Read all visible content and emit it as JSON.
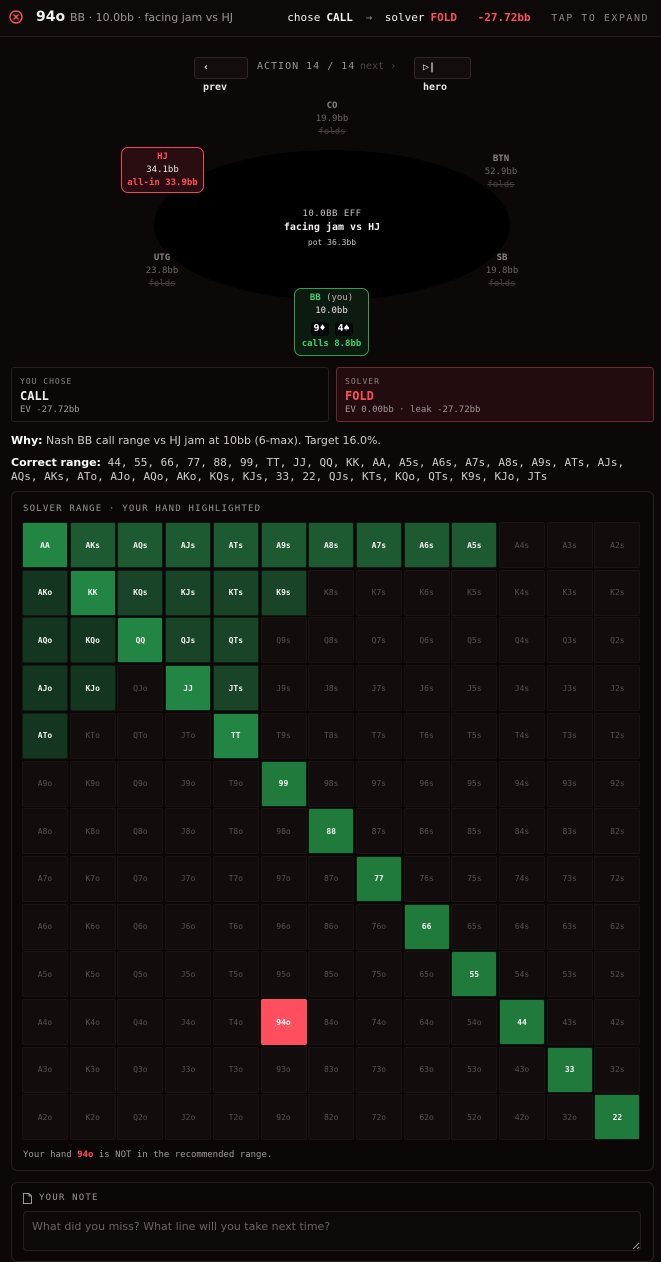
{
  "header": {
    "hand": "94o",
    "context": "BB · 10.0bb · facing jam vs HJ",
    "chose_label": "chose",
    "chose_action": "CALL",
    "arrow": "→",
    "solver_label": "solver",
    "solver_action": "FOLD",
    "ev_diff": "-27.72bb",
    "expand": "TAP TO EXPAND"
  },
  "nav": {
    "prev": "prev",
    "action": "ACTION 14 / 14",
    "next": "next",
    "hero": "hero"
  },
  "table": {
    "eff": "10.0BB EFF",
    "situation": "facing jam vs HJ",
    "pot": "pot 36.3bb",
    "seats": {
      "co": {
        "pos": "CO",
        "stack": "19.9bb",
        "status": "folds"
      },
      "hj": {
        "pos": "HJ",
        "stack": "34.1bb",
        "status": "all-in 33.9bb"
      },
      "btn": {
        "pos": "BTN",
        "stack": "52.9bb",
        "status": "folds"
      },
      "utg": {
        "pos": "UTG",
        "stack": "23.8bb",
        "status": "folds"
      },
      "sb": {
        "pos": "SB",
        "stack": "19.8bb",
        "status": "folds"
      },
      "bb": {
        "pos": "BB",
        "you": "(you)",
        "stack": "10.0bb",
        "card1": "9♦",
        "card2": "4♠",
        "status": "calls 8.8bb"
      }
    }
  },
  "you_chose": {
    "label": "YOU CHOSE",
    "action": "CALL",
    "ev": "EV -27.72bb"
  },
  "solver": {
    "label": "SOLVER",
    "action": "FOLD",
    "ev": "EV 0.00bb · leak -27.72bb"
  },
  "why": {
    "label": "Why:",
    "text": "Nash BB call range vs HJ jam at 10bb (6-max). Target 16.0%."
  },
  "correct_range": {
    "label": "Correct range:",
    "text": "44, 55, 66, 77, 88, 99, TT, JJ, QQ, KK, AA, A5s, A6s, A7s, A8s, A9s, ATs, AJs, AQs, AKs, ATo, AJo, AQo, AKo, KQs, KJs, 33, 22, QJs, KTs, KQo, QTs, K9s, KJo, JTs"
  },
  "grid": {
    "title": "SOLVER RANGE · YOUR HAND HIGHLIGHTED",
    "ranks": [
      "A",
      "K",
      "Q",
      "J",
      "T",
      "9",
      "8",
      "7",
      "6",
      "5",
      "4",
      "3",
      "2"
    ],
    "in_range": [
      "AA",
      "AKs",
      "AQs",
      "AJs",
      "ATs",
      "A9s",
      "A8s",
      "A7s",
      "A6s",
      "A5s",
      "AKo",
      "KK",
      "KQs",
      "KJs",
      "KTs",
      "K9s",
      "AQo",
      "KQo",
      "QQ",
      "QJs",
      "QTs",
      "AJo",
      "KJo",
      "JJ",
      "JTs",
      "ATo",
      "TT",
      "99",
      "88",
      "77",
      "66",
      "55",
      "44",
      "33",
      "22"
    ],
    "hero_hand": "94o",
    "note_prefix": "Your hand",
    "note_hand": "94o",
    "note_suffix": "is NOT in the recommended range."
  },
  "note": {
    "title": "YOUR NOTE",
    "placeholder": "What did you miss? What line will you take next time?"
  },
  "colors": {
    "accent_red": "#ff4f5e",
    "accent_green": "#2f9f52"
  }
}
